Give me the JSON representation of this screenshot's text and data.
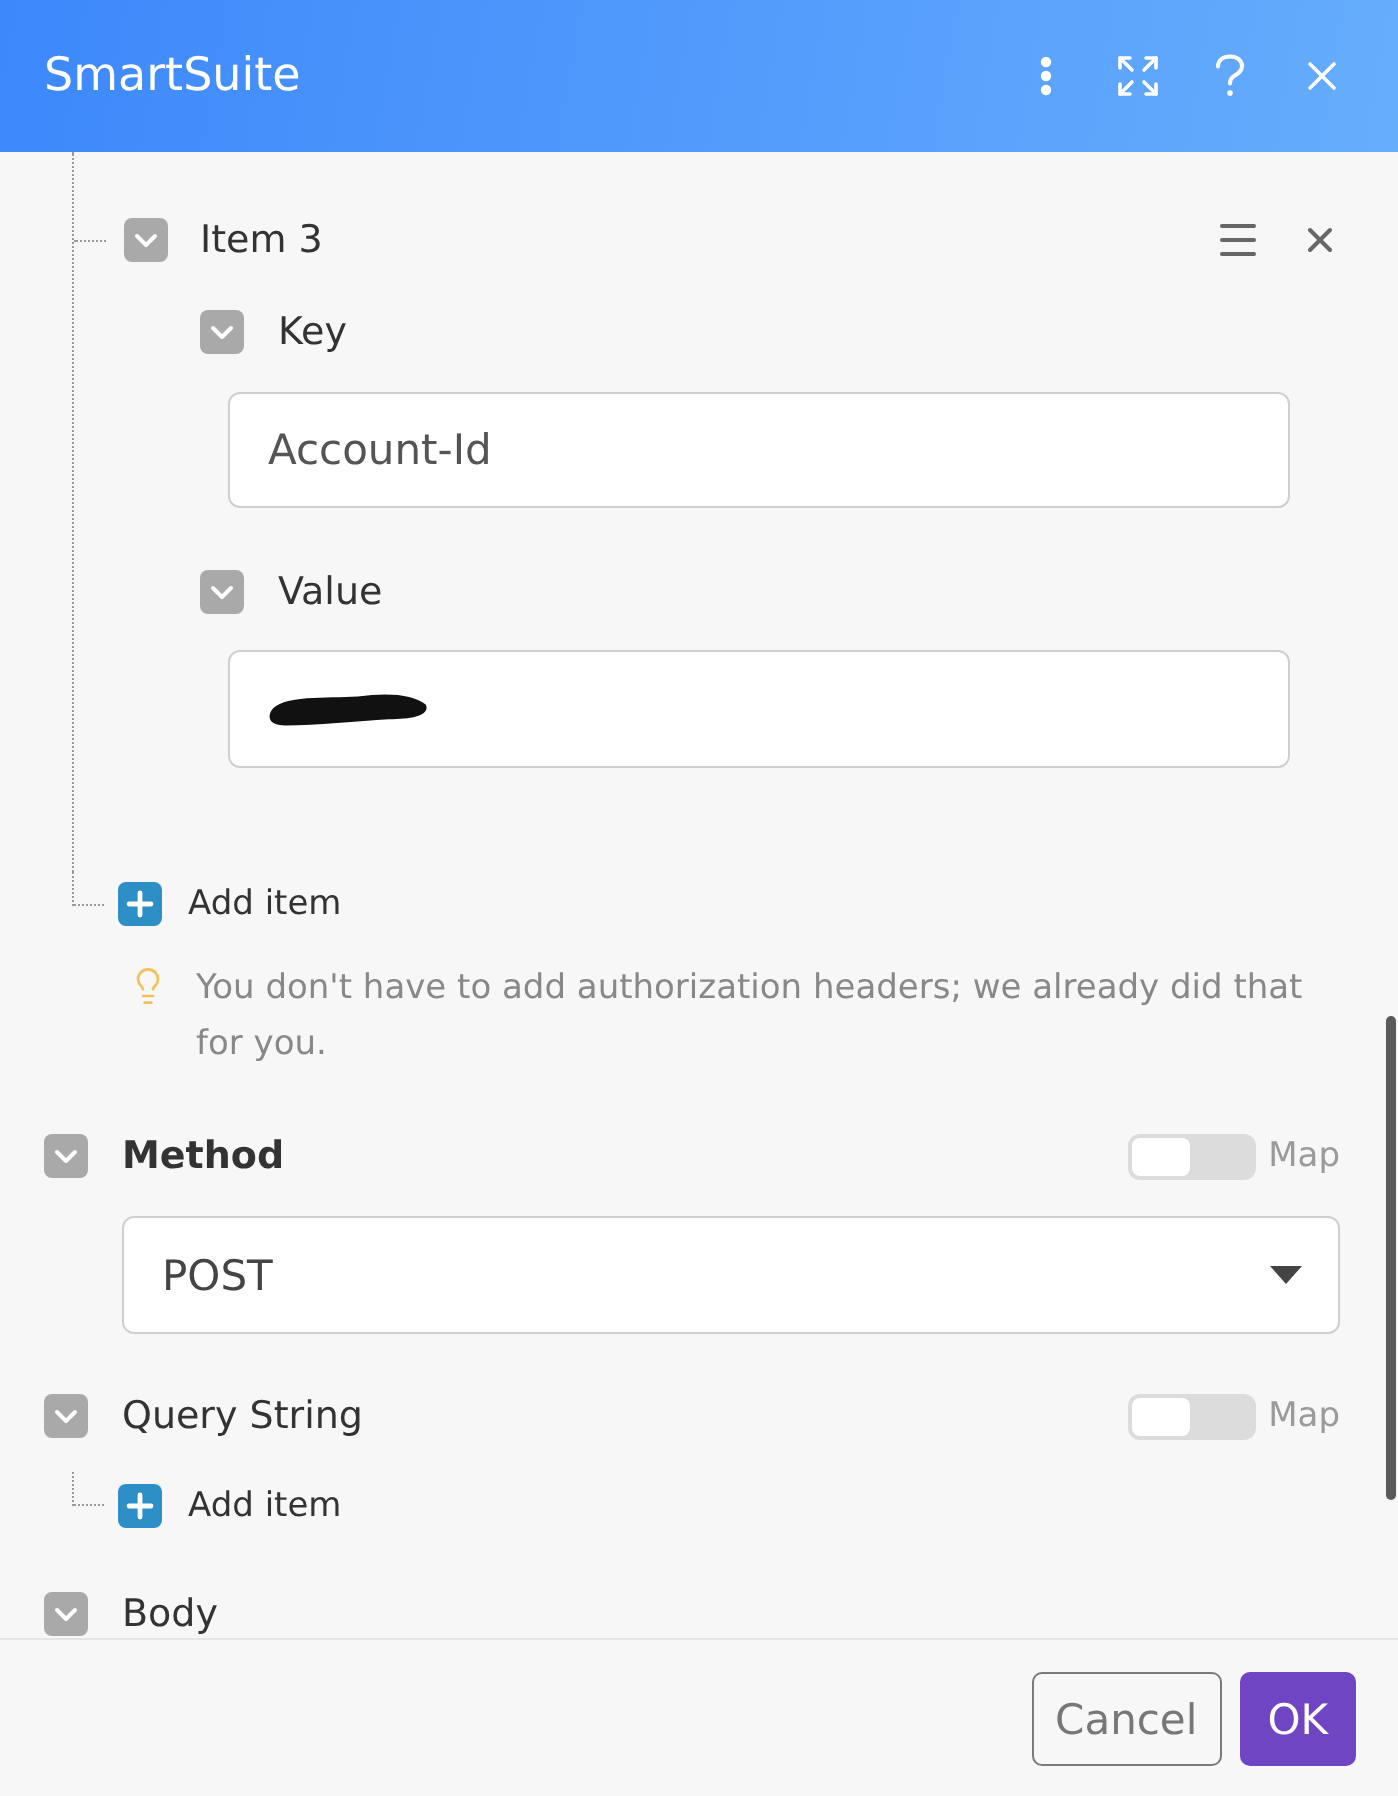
{
  "header": {
    "title": "SmartSuite",
    "actions": [
      {
        "kind": "more"
      },
      {
        "kind": "expand"
      },
      {
        "kind": "help"
      },
      {
        "kind": "close"
      }
    ]
  },
  "headers": {
    "items": [
      {
        "title": "Item 3",
        "expanded": true,
        "fields": [
          {
            "label": "Key",
            "expanded": true,
            "value": "Account-Id"
          },
          {
            "label": "Value",
            "expanded": true,
            "redacted": true
          }
        ]
      }
    ],
    "add_label": "Add item",
    "hint": "You don't have to add authorization headers; we already did that for you."
  },
  "sections": [
    {
      "kind": "select",
      "label": "Method",
      "required": true,
      "expanded": true,
      "map": {
        "label": "Map",
        "on": false
      },
      "value": "POST"
    },
    {
      "kind": "list",
      "label": "Query String",
      "required": false,
      "expanded": true,
      "map": {
        "label": "Map",
        "on": false
      },
      "add_label": "Add item"
    },
    {
      "kind": "plain",
      "label": "Body",
      "required": false,
      "expanded": true
    }
  ],
  "footer": {
    "buttons": [
      {
        "label": "Cancel",
        "kind": "secondary"
      },
      {
        "label": "OK",
        "kind": "primary"
      }
    ]
  }
}
